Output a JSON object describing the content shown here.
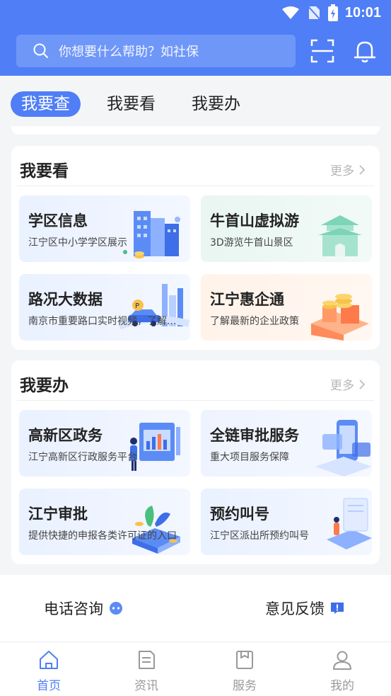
{
  "status": {
    "time": "10:01"
  },
  "search": {
    "placeholder": "你想要什么帮助？如社保"
  },
  "tabs": [
    {
      "label": "我要查",
      "active": true
    },
    {
      "label": "我要看",
      "active": false
    },
    {
      "label": "我要办",
      "active": false
    }
  ],
  "sections": {
    "watch": {
      "title": "我要看",
      "more": "更多",
      "tiles": [
        {
          "title": "学区信息",
          "subtitle": "江宁区中小学学区展示"
        },
        {
          "title": "牛首山虚拟游",
          "subtitle": "3D游览牛首山景区"
        },
        {
          "title": "路况大数据",
          "subtitle": "南京市重要路口实时视频，了解..."
        },
        {
          "title": "江宁惠企通",
          "subtitle": "了解最新的企业政策"
        }
      ]
    },
    "handle": {
      "title": "我要办",
      "more": "更多",
      "tiles": [
        {
          "title": "高新区政务",
          "subtitle": "江宁高新区行政服务平台"
        },
        {
          "title": "全链审批服务",
          "subtitle": "重大项目服务保障"
        },
        {
          "title": "江宁审批",
          "subtitle": "提供快捷的申报各类许可证的入口"
        },
        {
          "title": "预约叫号",
          "subtitle": "江宁区派出所预约叫号"
        }
      ]
    }
  },
  "contact": {
    "phone": "电话咨询",
    "feedback": "意见反馈"
  },
  "nav": [
    {
      "label": "首页",
      "icon": "home-icon",
      "active": true
    },
    {
      "label": "资讯",
      "icon": "news-icon",
      "active": false
    },
    {
      "label": "服务",
      "icon": "service-icon",
      "active": false
    },
    {
      "label": "我的",
      "icon": "user-icon",
      "active": false
    }
  ],
  "colors": {
    "primary": "#4f7ef6",
    "background": "#f4f5f7"
  }
}
